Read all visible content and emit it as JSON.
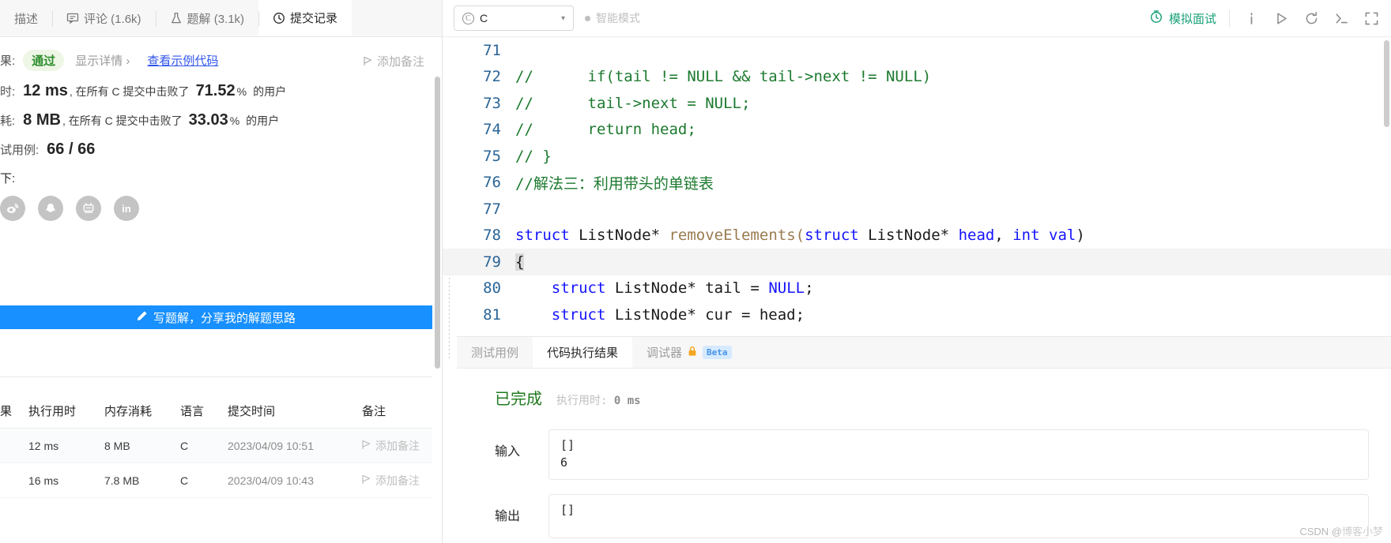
{
  "left_panel": {
    "tabs": [
      {
        "label": "描述",
        "icon": "document-icon",
        "active": false,
        "truncated": true
      },
      {
        "label": "评论 (1.6k)",
        "icon": "comment-icon",
        "active": false
      },
      {
        "label": "题解 (3.1k)",
        "icon": "flask-icon",
        "active": false
      },
      {
        "label": "提交记录",
        "icon": "clock-icon",
        "active": true
      }
    ],
    "result": {
      "result_label": "果:",
      "status": "通过",
      "show_detail": "显示详情 ›",
      "sample_code": "查看示例代码",
      "add_note": "添加备注",
      "time_label": "时:",
      "time_value": "12 ms",
      "time_desc_pre": ", 在所有 C 提交中击败了",
      "time_percent": "71.52",
      "percent_sign": "%",
      "desc_post": "的用户",
      "mem_label": "耗:",
      "mem_value": "8 MB",
      "mem_percent": "33.03",
      "cases_label": "试用例:",
      "cases_value": "66 / 66",
      "share_label": "下:"
    },
    "share_icons": [
      {
        "name": "weibo-icon",
        "glyph": "weibo"
      },
      {
        "name": "qq-icon",
        "glyph": "qq"
      },
      {
        "name": "bilibili-icon",
        "glyph": "bilibili"
      },
      {
        "name": "linkedin-icon",
        "glyph": "in"
      }
    ],
    "write_button": "写题解，分享我的解题思路",
    "table": {
      "headers": [
        "果",
        "执行用时",
        "内存消耗",
        "语言",
        "提交时间",
        "备注"
      ],
      "rows": [
        {
          "status": "",
          "runtime": "12 ms",
          "memory": "8 MB",
          "lang": "C",
          "time": "2023/04/09 10:51",
          "note": "添加备注"
        },
        {
          "status": "",
          "runtime": "16 ms",
          "memory": "7.8 MB",
          "lang": "C",
          "time": "2023/04/09 10:43",
          "note": "添加备注"
        }
      ]
    }
  },
  "toolbar": {
    "language": "C",
    "language_icon": "c-circle-icon",
    "smart_mode": "智能模式",
    "mock_interview": "模拟面试",
    "icons": [
      "info-icon",
      "run-icon",
      "reset-icon",
      "console-icon",
      "fullscreen-icon"
    ]
  },
  "editor": {
    "accent_comment": "#1c7a2e",
    "accent_keyword": "#1414ff",
    "accent_function": "#9a7b4f",
    "lines": [
      {
        "num": "71",
        "segments": []
      },
      {
        "num": "72",
        "segments": [
          {
            "t": "//      if(tail != NULL && tail->next != NULL)",
            "c": "cm"
          }
        ]
      },
      {
        "num": "73",
        "segments": [
          {
            "t": "//      tail->next = NULL;",
            "c": "cm"
          }
        ]
      },
      {
        "num": "74",
        "segments": [
          {
            "t": "//      return head;",
            "c": "cm"
          }
        ]
      },
      {
        "num": "75",
        "segments": [
          {
            "t": "// }",
            "c": "cm"
          }
        ]
      },
      {
        "num": "76",
        "segments": [
          {
            "t": "//解法三：利用带头的单链表",
            "c": "cm"
          }
        ]
      },
      {
        "num": "77",
        "segments": []
      },
      {
        "num": "78",
        "segments": [
          {
            "t": "struct",
            "c": "kw"
          },
          {
            "t": " ListNode* ",
            "c": "pl"
          },
          {
            "t": "removeElements",
            "c": "fn"
          },
          {
            "t": "(",
            "c": "fn"
          },
          {
            "t": "struct",
            "c": "kw"
          },
          {
            "t": " ListNode* ",
            "c": "pl"
          },
          {
            "t": "head",
            "c": "kw"
          },
          {
            "t": ", ",
            "c": "pl"
          },
          {
            "t": "int",
            "c": "kw"
          },
          {
            "t": " ",
            "c": "pl"
          },
          {
            "t": "val",
            "c": "kw"
          },
          {
            "t": ")",
            "c": "pl"
          }
        ]
      },
      {
        "num": "79",
        "current": true,
        "segments": [
          {
            "t": "{",
            "c": "brace-hl"
          }
        ]
      },
      {
        "num": "80",
        "segments": [
          {
            "t": "    ",
            "c": "pl"
          },
          {
            "t": "struct",
            "c": "kw"
          },
          {
            "t": " ListNode* tail = ",
            "c": "pl"
          },
          {
            "t": "NULL",
            "c": "kw"
          },
          {
            "t": ";",
            "c": "pl"
          }
        ]
      },
      {
        "num": "81",
        "segments": [
          {
            "t": "    ",
            "c": "pl"
          },
          {
            "t": "struct",
            "c": "kw"
          },
          {
            "t": " ListNode* cur = head;",
            "c": "pl"
          }
        ]
      }
    ]
  },
  "console": {
    "tabs": [
      {
        "label": "测试用例",
        "active": false
      },
      {
        "label": "代码执行结果",
        "active": true
      },
      {
        "label": "调试器",
        "active": false,
        "lock": true,
        "badge": "Beta"
      }
    ],
    "status": "已完成",
    "runtime_label": "执行用时:",
    "runtime_value": "0 ms",
    "io": [
      {
        "label": "输入",
        "value": "[]\n6"
      },
      {
        "label": "输出",
        "value": "[]"
      }
    ]
  },
  "watermark": {
    "prefix": "CSDN @",
    "author": "博客小梦"
  }
}
